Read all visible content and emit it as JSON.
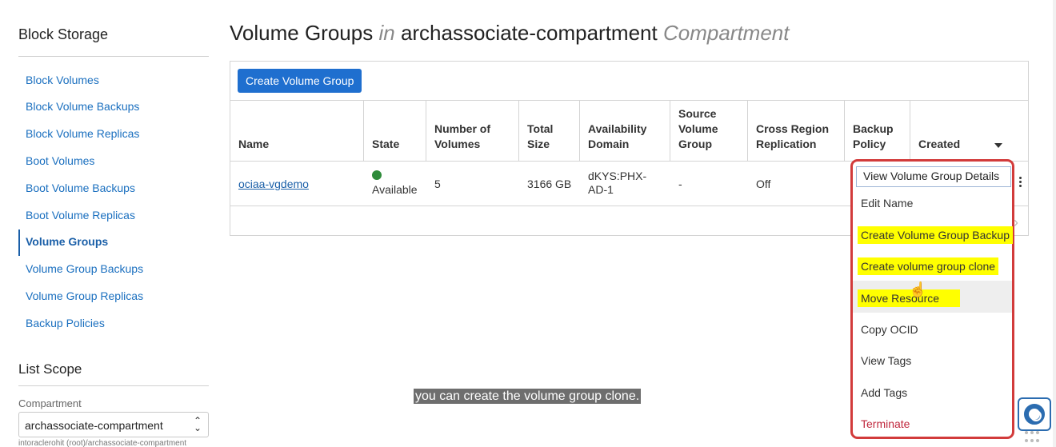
{
  "sidebar": {
    "title": "Block Storage",
    "items": [
      {
        "label": "Block Volumes"
      },
      {
        "label": "Block Volume Backups"
      },
      {
        "label": "Block Volume Replicas"
      },
      {
        "label": "Boot Volumes"
      },
      {
        "label": "Boot Volume Backups"
      },
      {
        "label": "Boot Volume Replicas"
      },
      {
        "label": "Volume Groups",
        "active": true
      },
      {
        "label": "Volume Group Backups"
      },
      {
        "label": "Volume Group Replicas"
      },
      {
        "label": "Backup Policies"
      }
    ],
    "list_scope": {
      "title": "List Scope",
      "compartment_label": "Compartment",
      "compartment_value": "archassociate-compartment",
      "compartment_path": "intoraclerohit (root)/archassociate-compartment"
    }
  },
  "main": {
    "title_name": "Volume Groups",
    "title_in": "in",
    "title_compartment": "archassociate-compartment",
    "title_suffix": "Compartment",
    "create_button": "Create Volume Group",
    "columns": [
      "Name",
      "State",
      "Number of Volumes",
      "Total Size",
      "Availability Domain",
      "Source Volume Group",
      "Cross Region Replication",
      "Backup Policy",
      "Created"
    ],
    "rows": [
      {
        "name": "ociaa-vgdemo",
        "state": "Available",
        "volumes": "5",
        "size": "3166 GB",
        "ad": "dKYS:PHX-AD-1",
        "source": "-",
        "replication": "Off"
      }
    ],
    "status_color": "#2e8b3a"
  },
  "menu": {
    "items": [
      {
        "label": "View Volume Group Details"
      },
      {
        "label": "Edit Name"
      },
      {
        "label": "Create Volume Group Backup",
        "highlighted": true
      },
      {
        "label": "Create volume group clone",
        "highlighted": true
      },
      {
        "label": "Move Resource",
        "highlighted": true,
        "hovered": true
      },
      {
        "label": "Copy OCID"
      },
      {
        "label": "View Tags"
      },
      {
        "label": "Add Tags"
      },
      {
        "label": "Terminate",
        "danger": true
      }
    ],
    "outline_color": "#d23b3b",
    "highlight_color": "#ffff00"
  },
  "caption": "you can create the volume group clone.",
  "colors": {
    "link": "#1a6fbf",
    "primary_button": "#1f6fcf",
    "danger": "#c0283d"
  },
  "icons": [
    "kebab-icon",
    "hand-cursor-icon",
    "help-lifebuoy-icon",
    "grid-dots-icon",
    "chevron-right-icon",
    "sort-caret-icon",
    "select-chevrons-icon"
  ]
}
